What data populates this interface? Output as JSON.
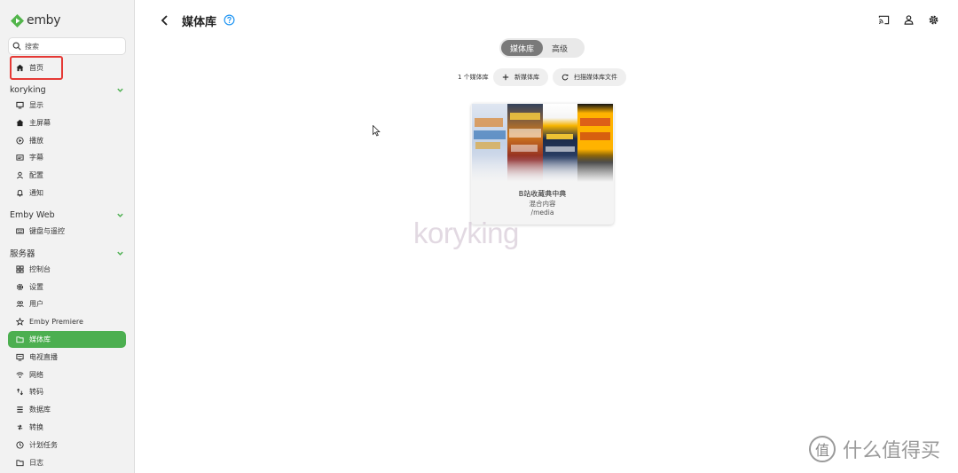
{
  "app": {
    "name": "emby",
    "brand_color": "#52b54b"
  },
  "search": {
    "placeholder": "搜索"
  },
  "sidebar": {
    "home": {
      "label": "首页",
      "icon": "home-icon"
    },
    "sections": [
      {
        "title": "koryking",
        "items": [
          {
            "label": "显示",
            "icon": "monitor-icon"
          },
          {
            "label": "主屏幕",
            "icon": "home-icon"
          },
          {
            "label": "播放",
            "icon": "play-circle-icon"
          },
          {
            "label": "字幕",
            "icon": "subtitles-icon"
          },
          {
            "label": "配置",
            "icon": "person-icon"
          },
          {
            "label": "通知",
            "icon": "bell-icon"
          }
        ]
      },
      {
        "title": "Emby Web",
        "items": [
          {
            "label": "键盘与遥控",
            "icon": "keyboard-icon"
          }
        ]
      },
      {
        "title": "服务器",
        "items": [
          {
            "label": "控制台",
            "icon": "dashboard-icon"
          },
          {
            "label": "设置",
            "icon": "gear-icon"
          },
          {
            "label": "用户",
            "icon": "people-icon"
          },
          {
            "label": "Emby Premiere",
            "icon": "star-icon"
          },
          {
            "label": "媒体库",
            "icon": "folder-icon",
            "active": true
          },
          {
            "label": "电视直播",
            "icon": "tv-icon"
          },
          {
            "label": "网络",
            "icon": "wifi-icon"
          },
          {
            "label": "转码",
            "icon": "transcode-icon"
          },
          {
            "label": "数据库",
            "icon": "database-icon"
          },
          {
            "label": "转换",
            "icon": "convert-icon"
          },
          {
            "label": "计划任务",
            "icon": "clock-icon"
          },
          {
            "label": "日志",
            "icon": "folder-icon"
          }
        ]
      }
    ]
  },
  "header": {
    "title": "媒体库"
  },
  "tabs": [
    {
      "label": "媒体库",
      "active": true
    },
    {
      "label": "高级",
      "active": false
    }
  ],
  "toolbar": {
    "count": "1 个媒体库",
    "new_library": "新媒体库",
    "scan_library": "扫描媒体库文件"
  },
  "library_card": {
    "name": "B站收藏典中典",
    "type": "混合内容",
    "path": "/media"
  },
  "watermark": {
    "text": "koryking"
  },
  "site_watermark": {
    "badge": "值",
    "text": "什么值得买"
  },
  "colors": {
    "accent": "#4caf50",
    "highlight_box": "#e53935",
    "help_icon": "#2196f3"
  }
}
